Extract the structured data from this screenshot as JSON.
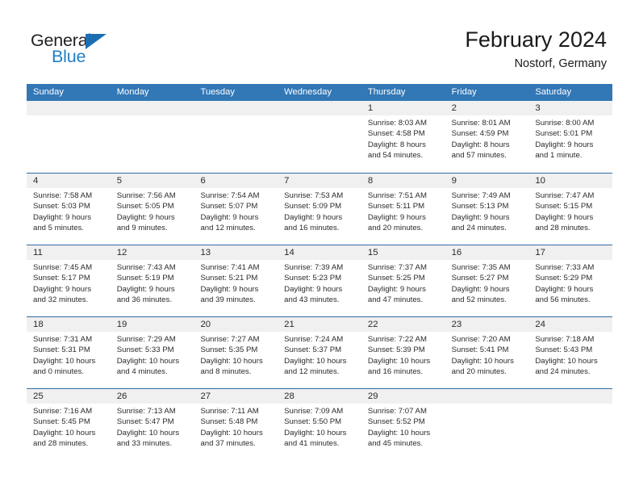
{
  "brand": {
    "name_part1": "General",
    "name_part2": "Blue"
  },
  "header": {
    "title": "February 2024",
    "subtitle": "Nostorf, Germany"
  },
  "colors": {
    "header_blue": "#3277b6",
    "separator_blue": "#2e6da4",
    "daynum_band": "#f0f0f0",
    "brand_blue": "#1f7fc4",
    "text": "#2b2b2b"
  },
  "weekdays": [
    "Sunday",
    "Monday",
    "Tuesday",
    "Wednesday",
    "Thursday",
    "Friday",
    "Saturday"
  ],
  "weeks": [
    [
      {
        "day": "",
        "lines": []
      },
      {
        "day": "",
        "lines": []
      },
      {
        "day": "",
        "lines": []
      },
      {
        "day": "",
        "lines": []
      },
      {
        "day": "1",
        "lines": [
          "Sunrise: 8:03 AM",
          "Sunset: 4:58 PM",
          "Daylight: 8 hours",
          "and 54 minutes."
        ]
      },
      {
        "day": "2",
        "lines": [
          "Sunrise: 8:01 AM",
          "Sunset: 4:59 PM",
          "Daylight: 8 hours",
          "and 57 minutes."
        ]
      },
      {
        "day": "3",
        "lines": [
          "Sunrise: 8:00 AM",
          "Sunset: 5:01 PM",
          "Daylight: 9 hours",
          "and 1 minute."
        ]
      }
    ],
    [
      {
        "day": "4",
        "lines": [
          "Sunrise: 7:58 AM",
          "Sunset: 5:03 PM",
          "Daylight: 9 hours",
          "and 5 minutes."
        ]
      },
      {
        "day": "5",
        "lines": [
          "Sunrise: 7:56 AM",
          "Sunset: 5:05 PM",
          "Daylight: 9 hours",
          "and 9 minutes."
        ]
      },
      {
        "day": "6",
        "lines": [
          "Sunrise: 7:54 AM",
          "Sunset: 5:07 PM",
          "Daylight: 9 hours",
          "and 12 minutes."
        ]
      },
      {
        "day": "7",
        "lines": [
          "Sunrise: 7:53 AM",
          "Sunset: 5:09 PM",
          "Daylight: 9 hours",
          "and 16 minutes."
        ]
      },
      {
        "day": "8",
        "lines": [
          "Sunrise: 7:51 AM",
          "Sunset: 5:11 PM",
          "Daylight: 9 hours",
          "and 20 minutes."
        ]
      },
      {
        "day": "9",
        "lines": [
          "Sunrise: 7:49 AM",
          "Sunset: 5:13 PM",
          "Daylight: 9 hours",
          "and 24 minutes."
        ]
      },
      {
        "day": "10",
        "lines": [
          "Sunrise: 7:47 AM",
          "Sunset: 5:15 PM",
          "Daylight: 9 hours",
          "and 28 minutes."
        ]
      }
    ],
    [
      {
        "day": "11",
        "lines": [
          "Sunrise: 7:45 AM",
          "Sunset: 5:17 PM",
          "Daylight: 9 hours",
          "and 32 minutes."
        ]
      },
      {
        "day": "12",
        "lines": [
          "Sunrise: 7:43 AM",
          "Sunset: 5:19 PM",
          "Daylight: 9 hours",
          "and 36 minutes."
        ]
      },
      {
        "day": "13",
        "lines": [
          "Sunrise: 7:41 AM",
          "Sunset: 5:21 PM",
          "Daylight: 9 hours",
          "and 39 minutes."
        ]
      },
      {
        "day": "14",
        "lines": [
          "Sunrise: 7:39 AM",
          "Sunset: 5:23 PM",
          "Daylight: 9 hours",
          "and 43 minutes."
        ]
      },
      {
        "day": "15",
        "lines": [
          "Sunrise: 7:37 AM",
          "Sunset: 5:25 PM",
          "Daylight: 9 hours",
          "and 47 minutes."
        ]
      },
      {
        "day": "16",
        "lines": [
          "Sunrise: 7:35 AM",
          "Sunset: 5:27 PM",
          "Daylight: 9 hours",
          "and 52 minutes."
        ]
      },
      {
        "day": "17",
        "lines": [
          "Sunrise: 7:33 AM",
          "Sunset: 5:29 PM",
          "Daylight: 9 hours",
          "and 56 minutes."
        ]
      }
    ],
    [
      {
        "day": "18",
        "lines": [
          "Sunrise: 7:31 AM",
          "Sunset: 5:31 PM",
          "Daylight: 10 hours",
          "and 0 minutes."
        ]
      },
      {
        "day": "19",
        "lines": [
          "Sunrise: 7:29 AM",
          "Sunset: 5:33 PM",
          "Daylight: 10 hours",
          "and 4 minutes."
        ]
      },
      {
        "day": "20",
        "lines": [
          "Sunrise: 7:27 AM",
          "Sunset: 5:35 PM",
          "Daylight: 10 hours",
          "and 8 minutes."
        ]
      },
      {
        "day": "21",
        "lines": [
          "Sunrise: 7:24 AM",
          "Sunset: 5:37 PM",
          "Daylight: 10 hours",
          "and 12 minutes."
        ]
      },
      {
        "day": "22",
        "lines": [
          "Sunrise: 7:22 AM",
          "Sunset: 5:39 PM",
          "Daylight: 10 hours",
          "and 16 minutes."
        ]
      },
      {
        "day": "23",
        "lines": [
          "Sunrise: 7:20 AM",
          "Sunset: 5:41 PM",
          "Daylight: 10 hours",
          "and 20 minutes."
        ]
      },
      {
        "day": "24",
        "lines": [
          "Sunrise: 7:18 AM",
          "Sunset: 5:43 PM",
          "Daylight: 10 hours",
          "and 24 minutes."
        ]
      }
    ],
    [
      {
        "day": "25",
        "lines": [
          "Sunrise: 7:16 AM",
          "Sunset: 5:45 PM",
          "Daylight: 10 hours",
          "and 28 minutes."
        ]
      },
      {
        "day": "26",
        "lines": [
          "Sunrise: 7:13 AM",
          "Sunset: 5:47 PM",
          "Daylight: 10 hours",
          "and 33 minutes."
        ]
      },
      {
        "day": "27",
        "lines": [
          "Sunrise: 7:11 AM",
          "Sunset: 5:48 PM",
          "Daylight: 10 hours",
          "and 37 minutes."
        ]
      },
      {
        "day": "28",
        "lines": [
          "Sunrise: 7:09 AM",
          "Sunset: 5:50 PM",
          "Daylight: 10 hours",
          "and 41 minutes."
        ]
      },
      {
        "day": "29",
        "lines": [
          "Sunrise: 7:07 AM",
          "Sunset: 5:52 PM",
          "Daylight: 10 hours",
          "and 45 minutes."
        ]
      },
      {
        "day": "",
        "lines": []
      },
      {
        "day": "",
        "lines": []
      }
    ]
  ]
}
